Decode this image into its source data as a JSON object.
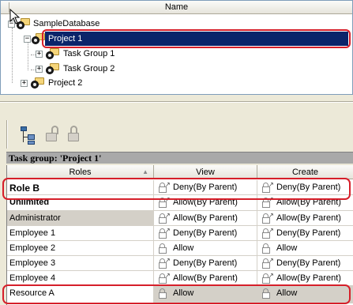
{
  "tree": {
    "column_header": "Name",
    "nodes": [
      {
        "label": "SampleDatabase",
        "expander": "−"
      },
      {
        "label": "Project 1",
        "expander": "−",
        "selected": true
      },
      {
        "label": "Task Group 1",
        "expander": "+"
      },
      {
        "label": "Task Group 2",
        "expander": "+"
      },
      {
        "label": "Project 2",
        "expander": "+"
      }
    ]
  },
  "toolbar": {
    "icons": [
      "hierarchy-icon",
      "unlock-icon",
      "lock-icon"
    ]
  },
  "group_header": "Task group: 'Project 1'",
  "grid": {
    "columns": [
      "Roles",
      "View",
      "Create"
    ],
    "rows": [
      {
        "role": "Role B",
        "view": "Deny(By Parent)",
        "create": "Deny(By Parent)"
      },
      {
        "role": "Unlimited",
        "view": "Allow(By Parent)",
        "create": "Allow(By Parent)"
      },
      {
        "role": "Administrator",
        "view": "Allow(By Parent)",
        "create": "Allow(By Parent)"
      },
      {
        "role": "Employee 1",
        "view": "Deny(By Parent)",
        "create": "Deny(By Parent)"
      },
      {
        "role": "Employee 2",
        "view": "Allow",
        "create": "Allow"
      },
      {
        "role": "Employee 3",
        "view": "Deny(By Parent)",
        "create": "Deny(By Parent)"
      },
      {
        "role": "Employee 4",
        "view": "Allow(By Parent)",
        "create": "Allow(By Parent)"
      },
      {
        "role": "Resource A",
        "view": "Allow",
        "create": "Allow"
      }
    ]
  },
  "colors": {
    "selection": "#0a246a",
    "highlight_outline": "#d61f2a",
    "window_bg": "#ece9d8",
    "grey_cell": "#d4d0c8"
  }
}
